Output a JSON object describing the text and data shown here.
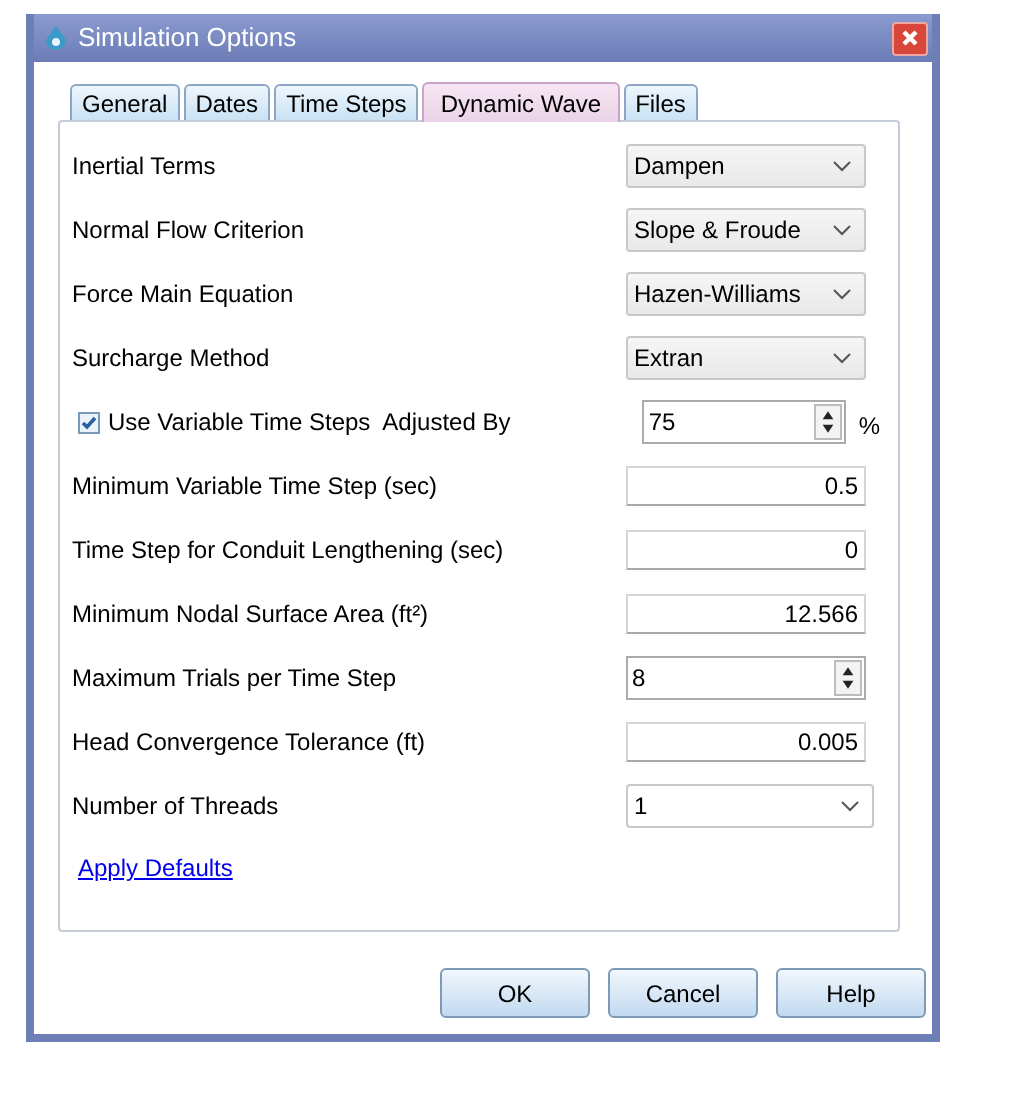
{
  "window": {
    "title": "Simulation Options"
  },
  "tabs": [
    {
      "label": "General",
      "selected": false
    },
    {
      "label": "Dates",
      "selected": false
    },
    {
      "label": "Time Steps",
      "selected": false
    },
    {
      "label": "Dynamic Wave",
      "selected": true
    },
    {
      "label": "Files",
      "selected": false
    }
  ],
  "rows": [
    {
      "kind": "dropdown",
      "label": "Inertial Terms",
      "value": "Dampen"
    },
    {
      "kind": "dropdown",
      "label": "Normal Flow Criterion",
      "value": "Slope & Froude"
    },
    {
      "kind": "dropdown",
      "label": "Force Main Equation",
      "value": "Hazen-Williams"
    },
    {
      "kind": "dropdown",
      "label": "Surcharge Method",
      "value": "Extran"
    },
    {
      "kind": "check-spinner",
      "label": "Use Variable Time Steps  Adjusted By",
      "checked": true,
      "value": "75",
      "unit": "%"
    },
    {
      "kind": "number",
      "label": "Minimum Variable Time Step (sec)",
      "value": "0.5"
    },
    {
      "kind": "number",
      "label": "Time Step for Conduit Lengthening (sec)",
      "value": "0"
    },
    {
      "kind": "number",
      "label": "Minimum Nodal Surface Area (ft²)",
      "value": "12.566"
    },
    {
      "kind": "spinner",
      "label": "Maximum Trials per Time Step",
      "value": "8"
    },
    {
      "kind": "number",
      "label": "Head Convergence Tolerance (ft)",
      "value": "0.005"
    },
    {
      "kind": "combo",
      "label": "Number of Threads",
      "value": "1"
    }
  ],
  "link": "Apply Defaults",
  "buttons": [
    "OK",
    "Cancel",
    "Help"
  ]
}
